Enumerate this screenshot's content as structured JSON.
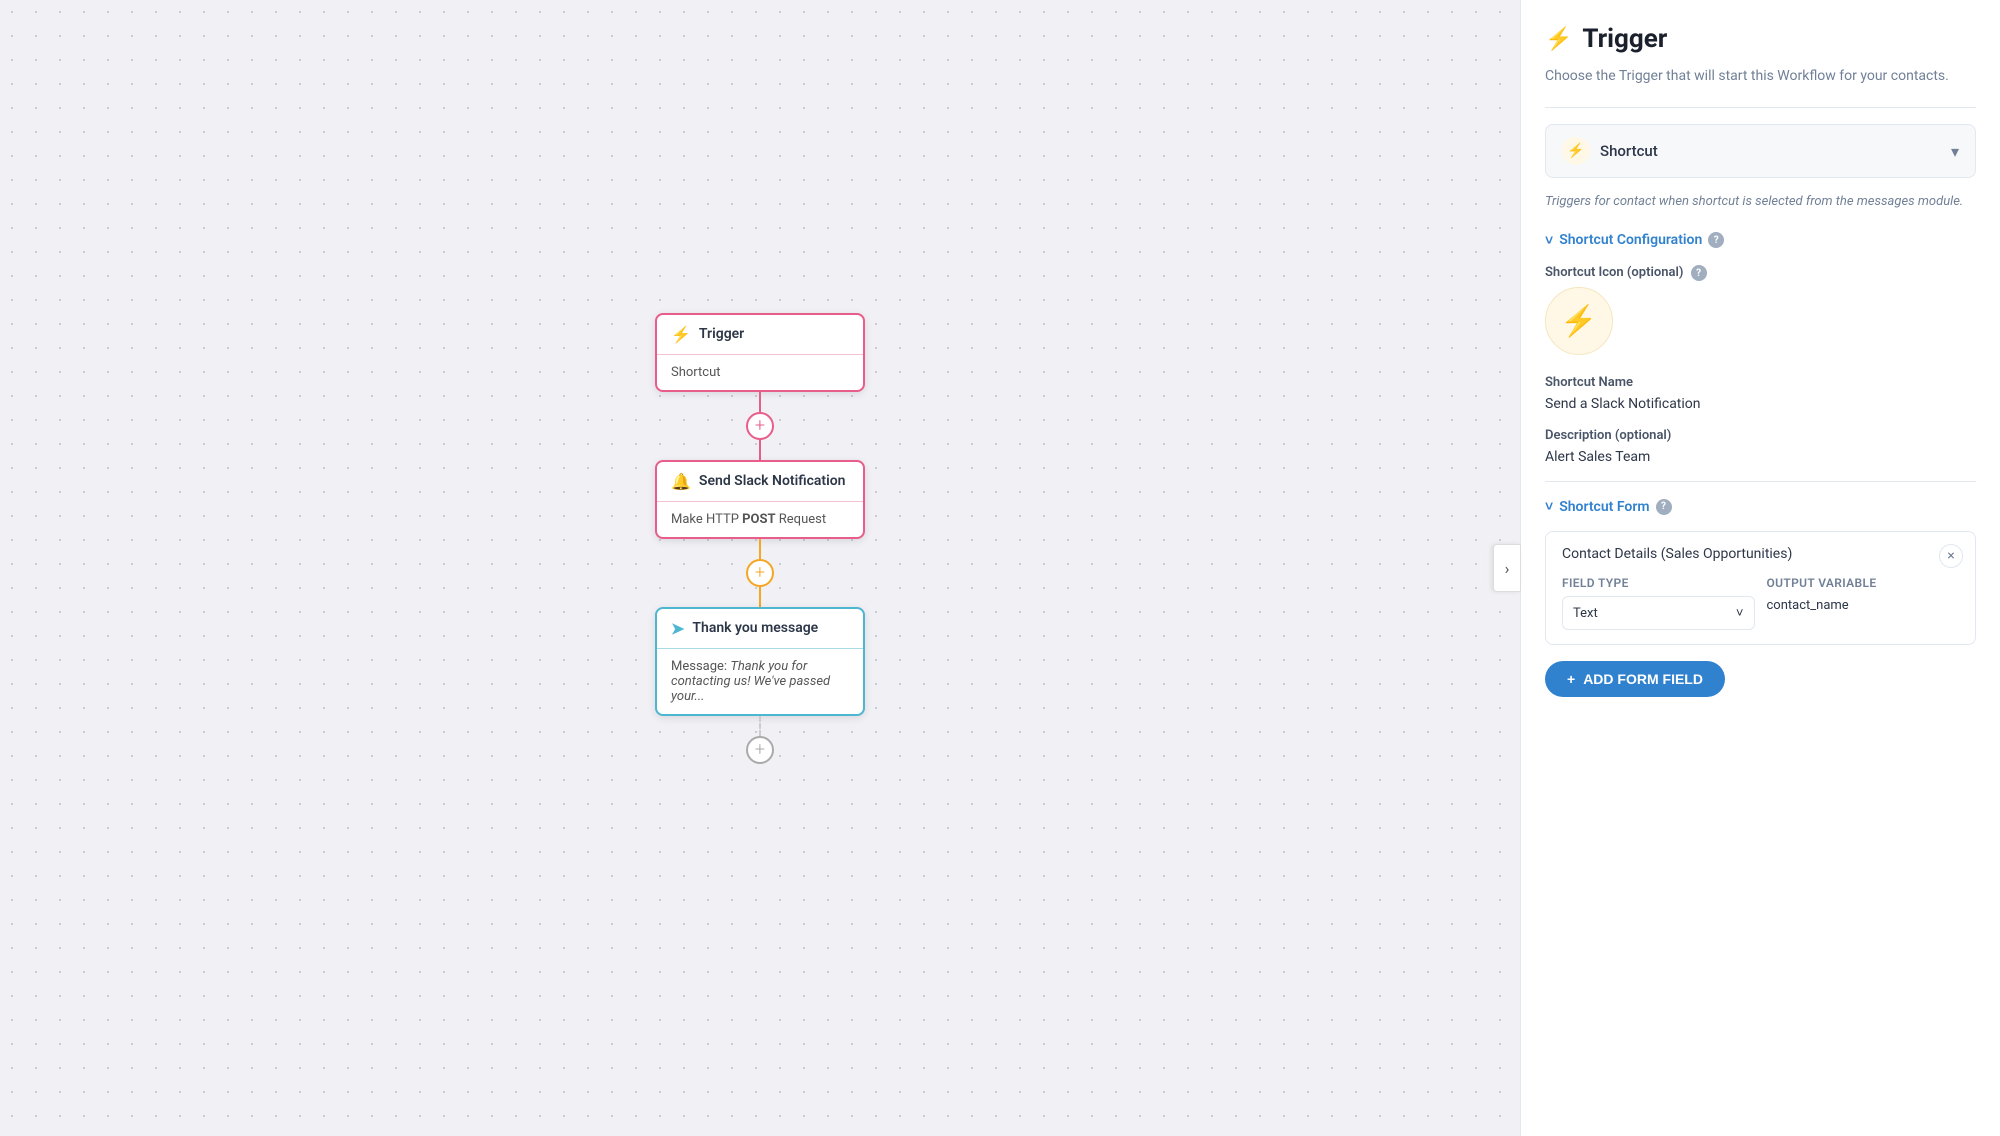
{
  "canvas": {
    "collapse_chevron": "›",
    "nodes": [
      {
        "id": "trigger",
        "type": "trigger",
        "header_icon": "⚡",
        "header_label": "Trigger",
        "content": "Shortcut"
      },
      {
        "id": "slack",
        "type": "action",
        "header_icon": "🔔",
        "header_label": "Send Slack Notification",
        "content_prefix": "Make HTTP ",
        "content_bold": "POST",
        "content_suffix": " Request"
      },
      {
        "id": "thank-you",
        "type": "message",
        "header_icon": "➤",
        "header_label": "Thank you message",
        "content_prefix": "Message: ",
        "content_italic": "Thank you for contacting us! We've passed your..."
      }
    ]
  },
  "panel": {
    "title": "Trigger",
    "title_icon": "⚡",
    "subtitle": "Choose the Trigger that will start this Workflow for your contacts.",
    "dropdown": {
      "icon": "⚡",
      "label": "Shortcut",
      "chevron": "▾"
    },
    "trigger_description": "Triggers for contact when shortcut is selected from the messages module.",
    "shortcut_config_section": {
      "label": "Shortcut Configuration",
      "chevron": "˅",
      "help": "?"
    },
    "icon_section": {
      "label": "Shortcut Icon (optional)",
      "help": "?",
      "preview_icon": "⚡"
    },
    "shortcut_name_label": "Shortcut Name",
    "shortcut_name_value": "Send a Slack Notification",
    "description_label": "Description (optional)",
    "description_value": "Alert Sales Team",
    "shortcut_form_section": {
      "label": "Shortcut Form",
      "chevron": "˅",
      "help": "?"
    },
    "form_field": {
      "name": "Contact Details (Sales Opportunities)",
      "close_icon": "×",
      "field_type_label": "Field Type",
      "field_type_value": "Text",
      "field_type_chevron": "˅",
      "output_var_label": "Output Variable",
      "output_var_value": "contact_name"
    },
    "add_form_field_btn": {
      "icon": "+",
      "label": "ADD FORM FIELD"
    }
  }
}
